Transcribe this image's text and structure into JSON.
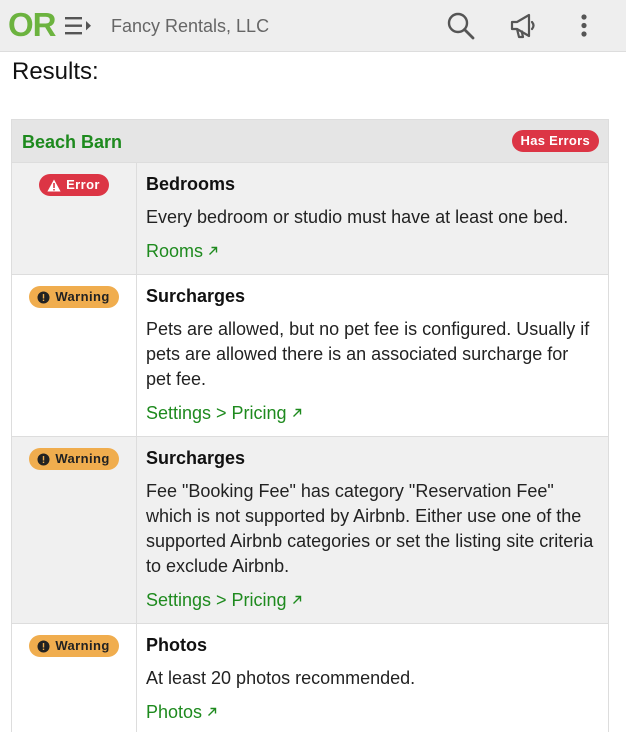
{
  "colors": {
    "brand_green": "#6cb33f",
    "link_green": "#1e8a1e",
    "error_red": "#dc3545",
    "warning_orange": "#f0ad4e"
  },
  "header": {
    "logo": "OR",
    "company": "Fancy Rentals, LLC",
    "icons": [
      "menu-toggle-icon",
      "search-icon",
      "megaphone-icon",
      "more-vertical-icon"
    ]
  },
  "page": {
    "title": "Results:"
  },
  "group": {
    "name": "Beach Barn",
    "status": "Has Errors",
    "issues": [
      {
        "severity": "Error",
        "title": "Bedrooms",
        "text": "Every bedroom or studio must have at least one bed.",
        "link": "Rooms"
      },
      {
        "severity": "Warning",
        "title": "Surcharges",
        "text": "Pets are allowed, but no pet fee is configured. Usually if pets are allowed there is an associated surcharge for pet fee.",
        "link": "Settings > Pricing"
      },
      {
        "severity": "Warning",
        "title": "Surcharges",
        "text": "Fee \"Booking Fee\" has category \"Reservation Fee\" which is not supported by Airbnb. Either use one of the supported Airbnb categories or set the listing site criteria to exclude Airbnb.",
        "link": "Settings > Pricing"
      },
      {
        "severity": "Warning",
        "title": "Photos",
        "text": "At least 20 photos recommended.",
        "link": "Photos"
      }
    ]
  }
}
